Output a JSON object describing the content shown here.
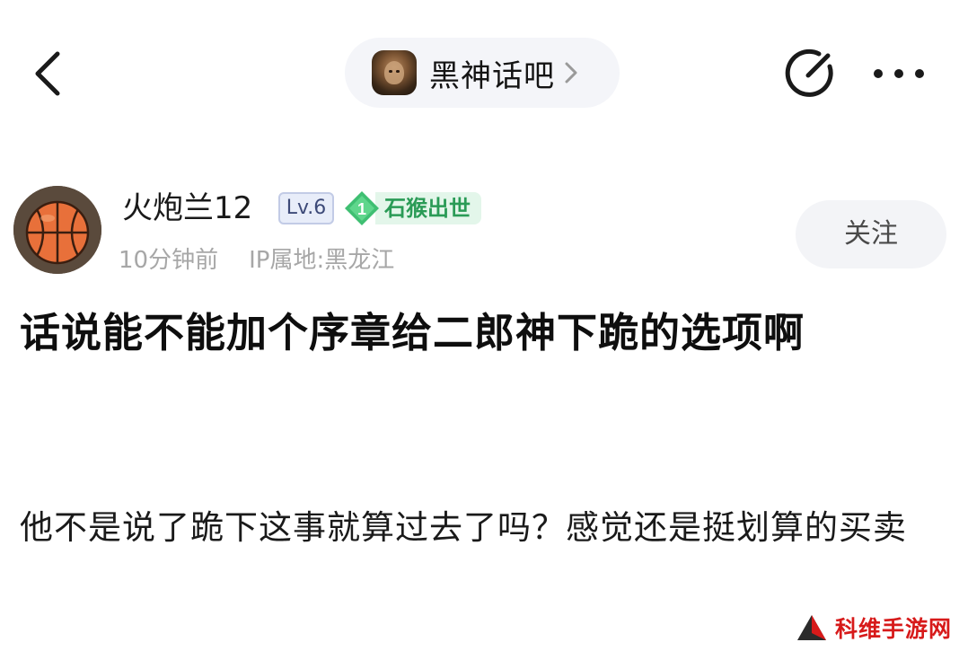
{
  "nav": {
    "forum_name": "黑神话吧",
    "back_icon": "chevron-left-icon",
    "chevron_icon": "chevron-right-icon",
    "edit_icon": "share-edit-icon",
    "more_icon": "more-horizontal-icon"
  },
  "author": {
    "name": "火炮兰12",
    "level": "Lv.6",
    "honor_rank": "1",
    "honor_title": "石猴出世",
    "time": "10分钟前",
    "ip_location": "IP属地:黑龙江",
    "follow_label": "关注",
    "avatar_icon": "basketball-avatar"
  },
  "post": {
    "title": "话说能不能加个序章给二郎神下跪的选项啊",
    "body": "他不是说了跪下这事就算过去了吗？感觉还是挺划算的买卖"
  },
  "watermark": {
    "text": "科维手游网"
  },
  "colors": {
    "pill_bg": "#f4f5f9",
    "level_badge_bg": "#e8edf9",
    "level_badge_text": "#3d4a78",
    "honor_green": "#2a9b56",
    "meta_gray": "#a7a7a7",
    "watermark_red": "#d71a1a"
  }
}
